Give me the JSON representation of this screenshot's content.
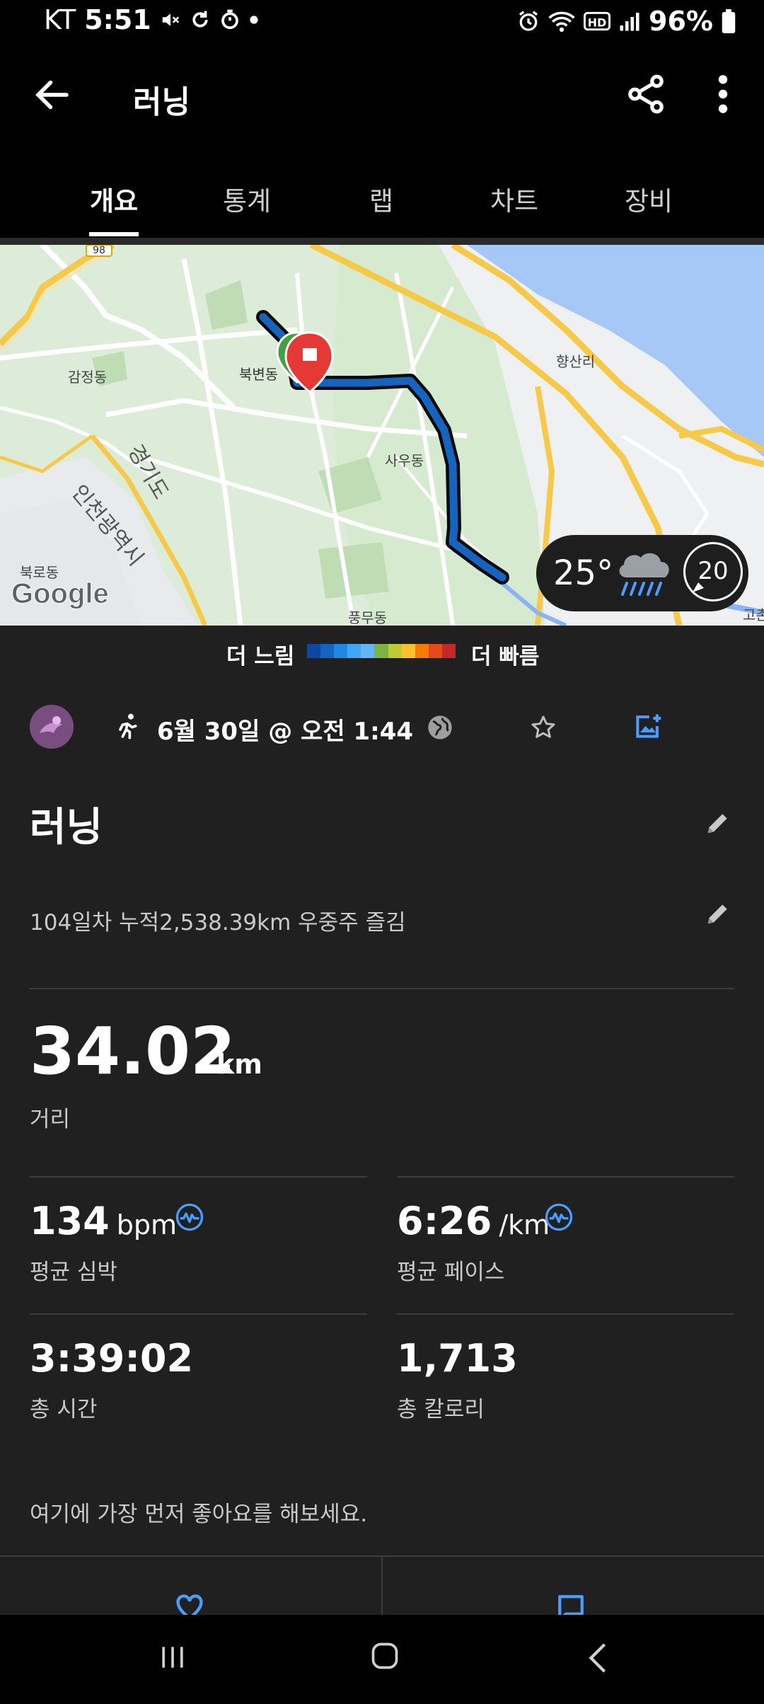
{
  "status_bar": {
    "carrier": "KT",
    "time": "5:51",
    "battery": "96%"
  },
  "app_bar": {
    "title": "러닝"
  },
  "tabs": [
    {
      "label": "개요",
      "active": true
    },
    {
      "label": "통계",
      "active": false
    },
    {
      "label": "랩",
      "active": false
    },
    {
      "label": "차트",
      "active": false
    },
    {
      "label": "장비",
      "active": false
    }
  ],
  "map": {
    "labels": {
      "road_badge": "98",
      "gamjeong": "감정동",
      "bukbyeon": "북변동",
      "hyangsan": "향산리",
      "sau": "사우동",
      "gyeonggi": "경기도",
      "incheon": "인천광역시",
      "bukro": "북로동",
      "pungmu": "풍무동",
      "edge": "고촌",
      "google": "Google"
    },
    "weather": {
      "temp": "25°",
      "wind": "20"
    }
  },
  "pace_legend": {
    "slow_label": "더 느림",
    "fast_label": "더 빠름",
    "colors": [
      "#0d47a1",
      "#1565c0",
      "#1e88e5",
      "#42a5f5",
      "#64b5f6",
      "#7cb342",
      "#c0ca33",
      "#fbc02d",
      "#f57c00",
      "#e64a19",
      "#c62828"
    ]
  },
  "activity": {
    "date": "6월 30일 @ 오전 1:44",
    "title": "러닝",
    "description": "104일차 누적2,538.39km  우중주 즐김",
    "distance": {
      "value": "34.02",
      "unit": "km",
      "label": "거리"
    },
    "stats": {
      "heart_rate": {
        "value": "134",
        "unit": "bpm",
        "label": "평균 심박"
      },
      "pace": {
        "value": "6:26",
        "unit": "/km",
        "label": "평균 페이스"
      },
      "time": {
        "value": "3:39:02",
        "label": "총 시간"
      },
      "calories": {
        "value": "1,713",
        "label": "총 칼로리"
      }
    },
    "like_prompt": "여기에 가장 먼저 좋아요를 해보세요."
  },
  "colors": {
    "accent": "#4a9eff",
    "background": "#202020",
    "route": "#1565c0"
  }
}
